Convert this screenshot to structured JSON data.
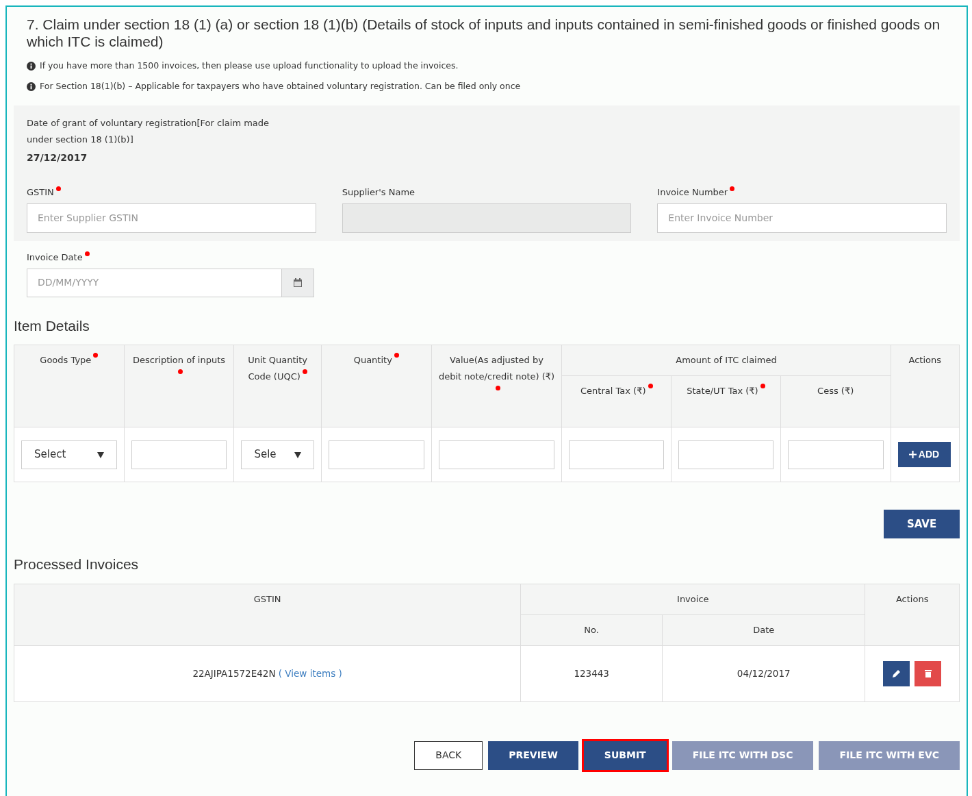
{
  "title": "7. Claim under section 18 (1) (a) or section 18 (1)(b) (Details of stock of inputs and inputs contained in semi-finished goods or finished goods on which ITC is claimed)",
  "notes": [
    "If you have more than 1500 invoices, then please use upload functionality to upload the invoices.",
    "For Section 18(1)(b) – Applicable for taxpayers who have obtained voluntary registration. Can be filed only once"
  ],
  "voluntary": {
    "label": "Date of grant of voluntary registration[For claim made under section 18 (1)(b)]",
    "value": "27/12/2017"
  },
  "fields": [
    {
      "label": "GSTIN",
      "required": true,
      "placeholder": "Enter Supplier GSTIN",
      "disabled": false
    },
    {
      "label": "Supplier's Name",
      "required": false,
      "disabled": true
    },
    {
      "label": "Invoice Number",
      "required": true,
      "placeholder": "Enter Invoice Number",
      "disabled": false
    }
  ],
  "invoice_date": {
    "label": "Invoice Date",
    "required": true,
    "placeholder": "DD/MM/YYYY"
  },
  "item_details": {
    "title": "Item Details",
    "columns": [
      {
        "label": "Goods Type",
        "required": true
      },
      {
        "label": "Description of inputs",
        "required": true
      },
      {
        "label": "Unit Quantity Code (UQC)",
        "required": true
      },
      {
        "label": "Quantity",
        "required": true
      },
      {
        "label": "Value(As adjusted by debit note/credit note) (₹)",
        "required": true
      }
    ],
    "group": {
      "label": "Amount of ITC claimed",
      "columns": [
        {
          "label": "Central Tax (₹)",
          "required": true
        },
        {
          "label": "State/UT Tax (₹)",
          "required": true
        },
        {
          "label": "Cess (₹)",
          "required": false
        }
      ]
    },
    "actions_label": "Actions",
    "inputs": [
      {
        "kind": "select",
        "value": "Select"
      },
      {
        "kind": "text"
      },
      {
        "kind": "select",
        "value": "Sele"
      },
      {
        "kind": "text"
      },
      {
        "kind": "text"
      },
      {
        "kind": "text"
      },
      {
        "kind": "text"
      },
      {
        "kind": "text"
      }
    ],
    "add_button": "ADD"
  },
  "save_button": "SAVE",
  "processed": {
    "title": "Processed Invoices",
    "headers": {
      "gstin": "GSTIN",
      "invoice": "Invoice",
      "no": "No.",
      "date": "Date",
      "actions": "Actions"
    },
    "rows": [
      {
        "gstin": "22AJIPA1572E42N",
        "link": "( View items )",
        "no": "123443",
        "date": "04/12/2017"
      }
    ]
  },
  "buttons": [
    {
      "label": "BACK",
      "kind": "outline",
      "highlighted": false,
      "disabled": false
    },
    {
      "label": "PREVIEW",
      "kind": "primary",
      "highlighted": false,
      "disabled": false
    },
    {
      "label": "SUBMIT",
      "kind": "primary",
      "highlighted": true,
      "disabled": false
    },
    {
      "label": "FILE ITC WITH DSC",
      "kind": "primary",
      "highlighted": false,
      "disabled": true
    },
    {
      "label": "FILE ITC WITH EVC",
      "kind": "primary",
      "highlighted": false,
      "disabled": true
    }
  ]
}
